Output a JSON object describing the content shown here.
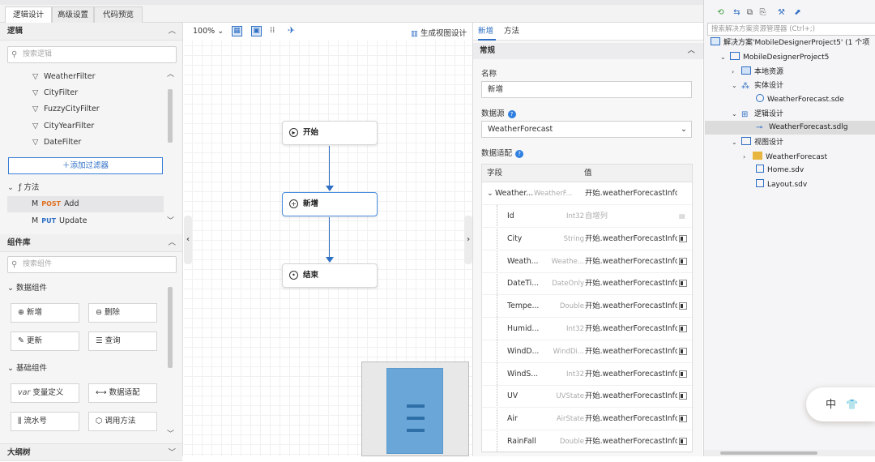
{
  "tabs": [
    "逻辑设计",
    "高级设置",
    "代码预览"
  ],
  "logic": {
    "title": "逻辑",
    "search_placeholder": "搜索逻辑",
    "filters": [
      "WeatherFilter",
      "CityFilter",
      "FuzzyCityFilter",
      "CityYearFilter",
      "DateFilter"
    ],
    "add_filter": "添加过滤器",
    "methods_label": "方法",
    "methods": [
      {
        "verb": "POST",
        "name": "Add"
      },
      {
        "verb": "PUT",
        "name": "Update"
      }
    ]
  },
  "components": {
    "title": "组件库",
    "search_placeholder": "搜索组件",
    "data_group": "数据组件",
    "data_items": [
      "新增",
      "删除",
      "更新",
      "查询"
    ],
    "basic_group": "基础组件",
    "basic_items": [
      "变量定义",
      "数据适配",
      "流水号",
      "调用方法"
    ],
    "var_prefix": "var"
  },
  "outline": {
    "title": "大纲树"
  },
  "canvas": {
    "zoom": "100%",
    "generate_view": "生成视图设计",
    "nodes": [
      "开始",
      "新增",
      "结束"
    ]
  },
  "props": {
    "tabs": [
      "新增",
      "方法"
    ],
    "section": "常规",
    "name_label": "名称",
    "name_value": "新增",
    "datasource_label": "数据源",
    "datasource_value": "WeatherForecast",
    "adapter_label": "数据适配",
    "grid_headers": [
      "字段",
      "值"
    ],
    "parent_row": {
      "field": "Weather...",
      "type": "WeatherF...",
      "value": "开始.weatherForecastInfo"
    },
    "rows": [
      {
        "field": "Id",
        "type": "Int32",
        "value": "自增列"
      },
      {
        "field": "City",
        "type": "String",
        "value": "开始.weatherForecastInfo.C"
      },
      {
        "field": "Weath...",
        "type": "Weathe...",
        "value": "开始.weatherForecastInfo.V"
      },
      {
        "field": "DateTi...",
        "type": "DateOnly",
        "value": "开始.weatherForecastInfo.D"
      },
      {
        "field": "Tempe...",
        "type": "Double",
        "value": "开始.weatherForecastInfo.T"
      },
      {
        "field": "Humid...",
        "type": "Int32",
        "value": "开始.weatherForecastInfo.H"
      },
      {
        "field": "WindD...",
        "type": "WindDi...",
        "value": "开始.weatherForecastInfo.V"
      },
      {
        "field": "WindS...",
        "type": "Int32",
        "value": "开始.weatherForecastInfo.V"
      },
      {
        "field": "UV",
        "type": "UVState",
        "value": "开始.weatherForecastInfo.U"
      },
      {
        "field": "Air",
        "type": "AirState",
        "value": "开始.weatherForecastInfo.A"
      },
      {
        "field": "RainFall",
        "type": "Double",
        "value": "开始.weatherForecastInfo.R"
      }
    ]
  },
  "solution": {
    "search_placeholder": "搜索解决方案资源管理器 (Ctrl+;)",
    "solution_node": "解决方案'MobileDesignerProject5' (1 个项",
    "project": "MobileDesignerProject5",
    "local_res": "本地资源",
    "entity": "实体设计",
    "entity_file": "WeatherForecast.sde",
    "logic": "逻辑设计",
    "logic_file": "WeatherForecast.sdlg",
    "view": "视图设计",
    "view_folder": "WeatherForecast",
    "home": "Home.sdv",
    "layout": "Layout.sdv"
  },
  "ime": {
    "label": "中"
  },
  "colors": {
    "accent": "#2f6fc4",
    "post": "#e07020"
  }
}
